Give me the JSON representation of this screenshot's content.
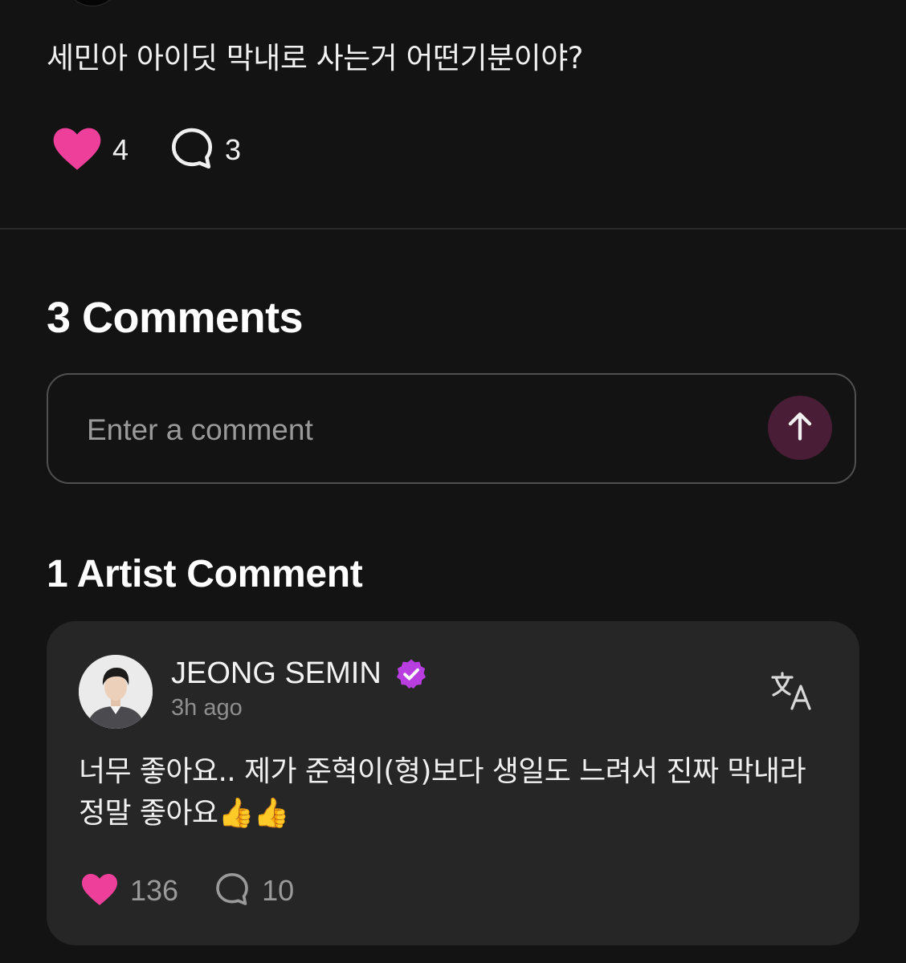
{
  "post": {
    "text": "세민아 아이딧 막내로 사는거 어떤기분이야?",
    "like_count": "4",
    "comment_count": "3"
  },
  "comments": {
    "heading": "3 Comments",
    "input_placeholder": "Enter a comment"
  },
  "artist_comments": {
    "heading": "1 Artist Comment",
    "items": [
      {
        "author": "JEONG SEMIN",
        "timestamp": "3h ago",
        "text": "너무 좋아요.. 제가 준혁이(형)보다 생일도 느려서 진짜 막내라 정말 좋아요👍👍",
        "like_count": "136",
        "reply_count": "10"
      }
    ]
  },
  "colors": {
    "background": "#131313",
    "heart": "#ee3f9b",
    "verified_badge": "#b93ee0",
    "send_button_bg": "#4a1d36",
    "card_bg": "#262626"
  },
  "icons": {
    "like": "heart-icon",
    "comment": "speech-bubble-icon",
    "send": "arrow-up-icon",
    "verified": "verified-badge-icon",
    "translate": "translate-icon"
  }
}
